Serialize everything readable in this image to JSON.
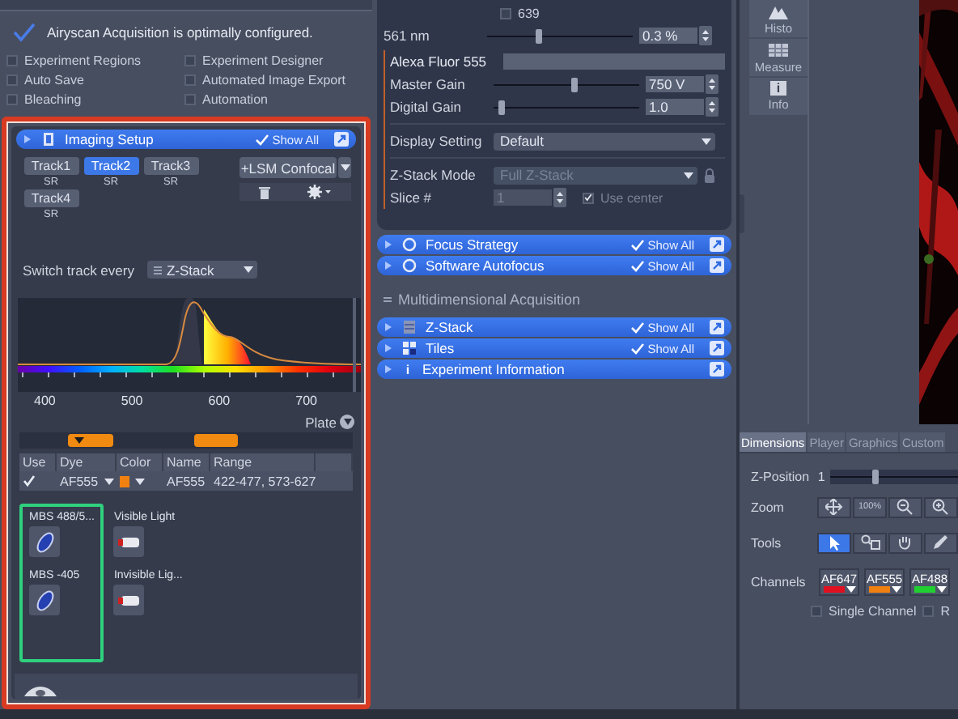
{
  "airyscan": {
    "message": "Airyscan Acquisition is optimally configured.",
    "ok": true
  },
  "options": [
    {
      "label": "Experiment Regions",
      "checked": false
    },
    {
      "label": "Experiment Designer",
      "checked": false
    },
    {
      "label": "Auto Save",
      "checked": false
    },
    {
      "label": "Automated Image Export",
      "checked": false
    },
    {
      "label": "Bleaching",
      "checked": false
    },
    {
      "label": "Automation",
      "checked": false
    }
  ],
  "imaging_setup": {
    "title": "Imaging Setup",
    "show_all": "Show All",
    "highlighted": true,
    "tracks": [
      {
        "label": "Track1",
        "mode": "SR",
        "selected": false
      },
      {
        "label": "Track2",
        "mode": "SR",
        "selected": true
      },
      {
        "label": "Track3",
        "mode": "SR",
        "selected": false
      },
      {
        "label": "Track4",
        "mode": "SR",
        "selected": false
      }
    ],
    "add_button": "+LSM Confocal",
    "switch": {
      "label": "Switch track every",
      "value": "Z-Stack"
    },
    "spectrum_axis": [
      "400",
      "500",
      "600",
      "700"
    ],
    "plate_label": "Plate",
    "channel_table": {
      "columns": [
        "Use",
        "Dye",
        "Color",
        "Name",
        "Range"
      ],
      "rows": [
        {
          "use": true,
          "dye": "AF555",
          "color": "#f08010",
          "name": "AF555",
          "range": "422-477, 573-627"
        }
      ]
    },
    "light_path": {
      "splitters_highlighted": true,
      "nodes": [
        {
          "label": "MBS 488/5...",
          "kind": "beamsplitter"
        },
        {
          "label": "Visible Light",
          "kind": "lamp"
        },
        {
          "label": "MBS -405",
          "kind": "beamsplitter"
        },
        {
          "label": "Invisible Lig...",
          "kind": "lamp"
        }
      ]
    }
  },
  "laser_panel": {
    "lines": [
      {
        "label": "639",
        "checked": false
      }
    ],
    "laser": {
      "label": "561 nm",
      "level": 0.35,
      "value": "0.3 %"
    },
    "channel": {
      "name": "Alexa Fluor 555",
      "color": "#c0602a"
    },
    "gains": [
      {
        "label": "Master Gain",
        "level": 0.55,
        "value": "750 V"
      },
      {
        "label": "Digital Gain",
        "level": 0.05,
        "value": "1.0"
      }
    ],
    "display_setting": {
      "label": "Display Setting",
      "value": "Default"
    },
    "zstack_mode": {
      "label": "Z-Stack Mode",
      "value": "Full Z-Stack",
      "disabled": true
    },
    "slice": {
      "label": "Slice #",
      "value": "1",
      "disabled": true,
      "use_center": {
        "label": "Use center",
        "checked": true
      }
    }
  },
  "tool_groups": [
    {
      "title": "Focus Strategy",
      "show_all": "Show All",
      "kind": "ring"
    },
    {
      "title": "Software Autofocus",
      "show_all": "Show All",
      "kind": "ring"
    }
  ],
  "section_title": "Multidimensional Acquisition",
  "md_groups": [
    {
      "title": "Z-Stack",
      "show_all": "Show All",
      "kind": "stack"
    },
    {
      "title": "Tiles",
      "show_all": "Show All",
      "kind": "tiles"
    },
    {
      "title": "Experiment Information",
      "kind": "info",
      "icon_text": "i"
    }
  ],
  "view_tools": [
    {
      "label": "Histo",
      "kind": "histogram"
    },
    {
      "label": "Measure",
      "kind": "table"
    },
    {
      "label": "Info",
      "kind": "info",
      "icon_text": "i"
    }
  ],
  "view_tabs": [
    {
      "label": "Dimensions",
      "selected": true
    },
    {
      "label": "Player",
      "selected": false
    },
    {
      "label": "Graphics",
      "selected": false
    },
    {
      "label": "Custom",
      "selected": false
    }
  ],
  "dimensions": {
    "z_position": {
      "label": "Z-Position",
      "value": "1",
      "level": 0.35
    },
    "zoom": {
      "label": "Zoom",
      "buttons": [
        {
          "kind": "fit"
        },
        {
          "kind": "text",
          "label": "100%"
        },
        {
          "kind": "zoom-out"
        },
        {
          "kind": "zoom-in"
        }
      ]
    },
    "tools": {
      "label": "Tools",
      "buttons": [
        {
          "kind": "pointer",
          "selected": true
        },
        {
          "kind": "zoom-rect",
          "selected": false
        },
        {
          "kind": "hand",
          "selected": false
        },
        {
          "kind": "pen",
          "selected": false
        }
      ]
    },
    "channels": {
      "label": "Channels",
      "items": [
        {
          "name": "AF647",
          "color": "#e01020"
        },
        {
          "name": "AF555",
          "color": "#f08010"
        },
        {
          "name": "AF488",
          "color": "#20d030"
        }
      ]
    },
    "checks": [
      {
        "label": "Single Channel",
        "checked": false
      },
      {
        "label": "R",
        "checked": false
      }
    ]
  }
}
